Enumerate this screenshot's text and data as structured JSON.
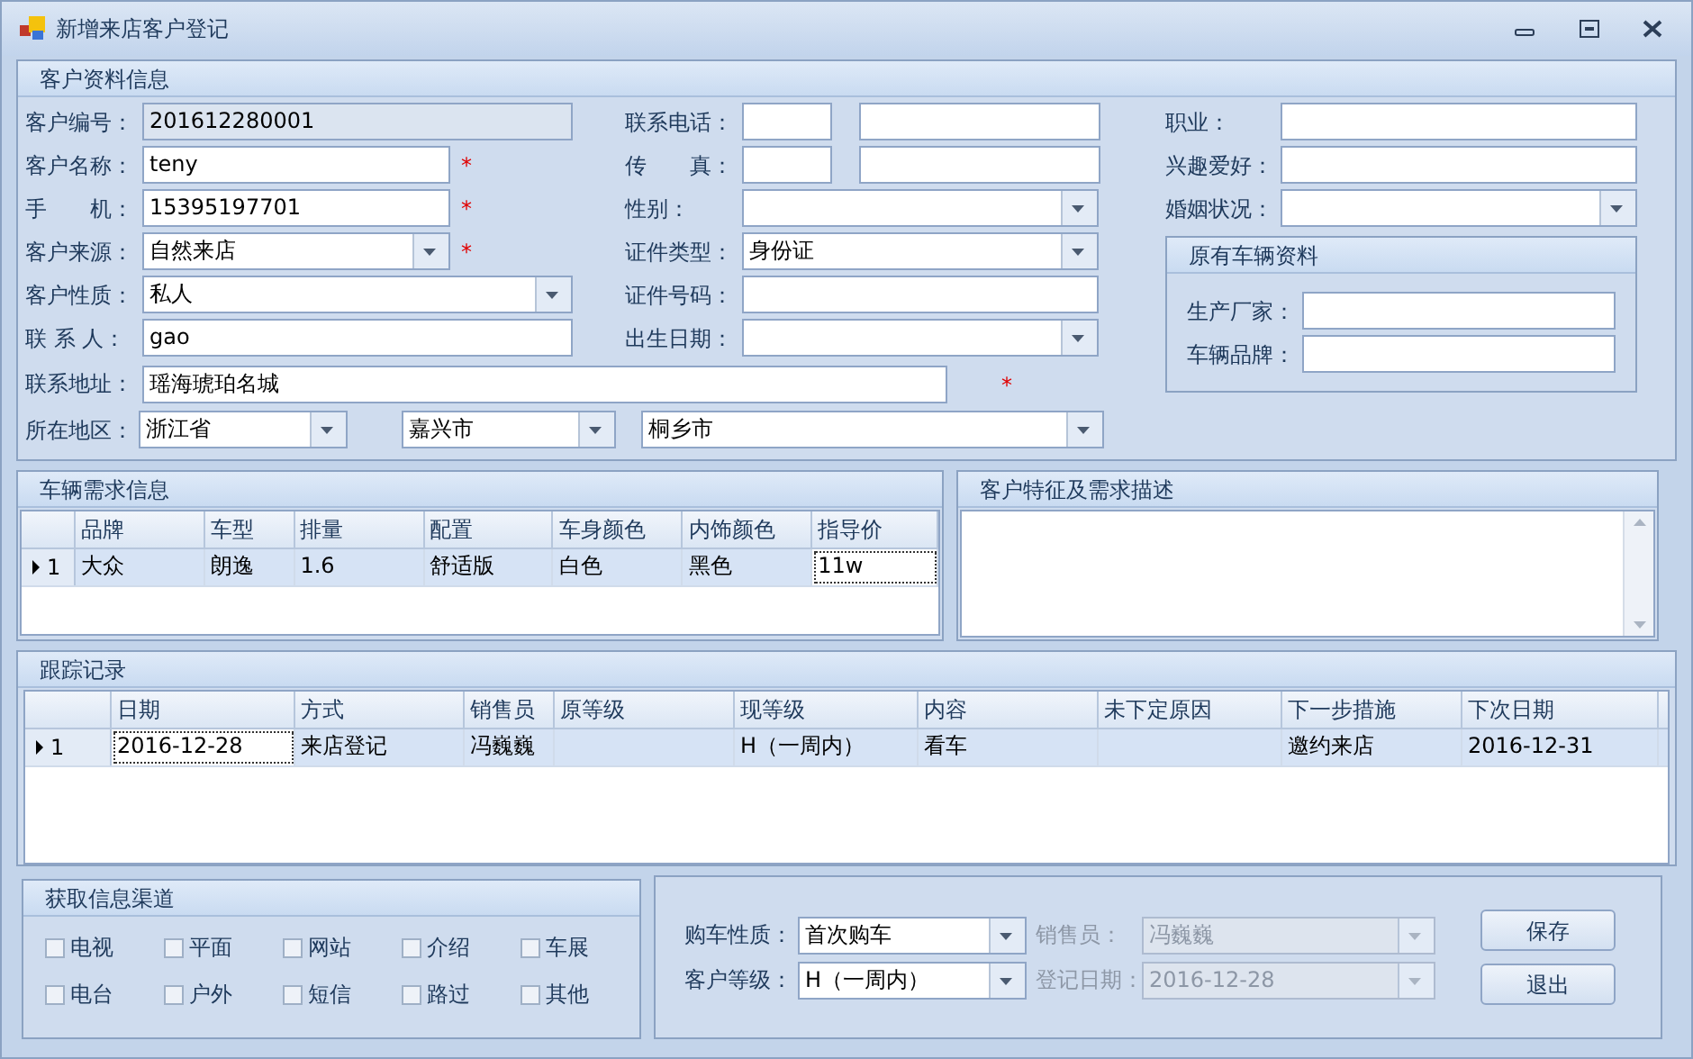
{
  "window": {
    "title": "新增来店客户登记"
  },
  "customer_info": {
    "title": "客户资料信息",
    "rows": [
      {
        "left": {
          "label": "客户编号：",
          "kind": "readonly",
          "value": "201612280001"
        },
        "right": {
          "label": "联系电话：",
          "kind": "pair"
        }
      },
      {
        "left": {
          "label": "客户名称：",
          "kind": "text",
          "value": "teny",
          "required_mark": "*"
        },
        "right": {
          "label": "传　　真：",
          "kind": "pair"
        }
      },
      {
        "left": {
          "label": "手　　机：",
          "kind": "text",
          "value": "15395197701",
          "required_mark": "*"
        },
        "right": {
          "label": "性别：",
          "kind": "combo"
        }
      },
      {
        "left": {
          "label": "客户来源：",
          "kind": "combo",
          "value": "自然来店",
          "required_mark": "*"
        },
        "right": {
          "label": "证件类型：",
          "kind": "combo",
          "value": "身份证"
        }
      },
      {
        "left": {
          "label": "客户性质：",
          "kind": "combo",
          "value": "私人"
        },
        "right": {
          "label": "证件号码：",
          "kind": "text"
        }
      },
      {
        "left": {
          "label": "联 系 人：",
          "kind": "text",
          "value": "gao"
        },
        "right": {
          "label": "出生日期：",
          "kind": "combo"
        }
      }
    ],
    "address": {
      "label": "联系地址：",
      "value": "瑶海琥珀名城",
      "required_mark": "*"
    },
    "region": {
      "label": "所在地区：",
      "values": [
        "浙江省",
        "嘉兴市",
        "桐乡市"
      ]
    },
    "extra": [
      {
        "label": "职业：",
        "kind": "text"
      },
      {
        "label": "兴趣爱好：",
        "kind": "text"
      },
      {
        "label": "婚姻状况：",
        "kind": "combo"
      }
    ],
    "old_vehicle": {
      "title": "原有车辆资料",
      "fields": [
        {
          "label": "生产厂家："
        },
        {
          "label": "车辆品牌："
        }
      ]
    }
  },
  "vehicle_needs": {
    "title": "车辆需求信息",
    "columns": [
      "品牌",
      "车型",
      "排量",
      "配置",
      "车身颜色",
      "内饰颜色",
      "指导价"
    ],
    "rows": [
      {
        "number": "1",
        "selected": true,
        "cells": [
          {
            "text": "大众",
            "current": false
          },
          {
            "text": "朗逸",
            "current": false
          },
          {
            "text": "1.6",
            "current": false
          },
          {
            "text": "舒适版",
            "current": false
          },
          {
            "text": "白色",
            "current": false
          },
          {
            "text": "黑色",
            "current": false
          },
          {
            "text": "11w",
            "current": true
          }
        ]
      }
    ]
  },
  "description": {
    "title": "客户特征及需求描述"
  },
  "tracking": {
    "title": "跟踪记录",
    "columns": [
      "日期",
      "方式",
      "销售员",
      "原等级",
      "现等级",
      "内容",
      "未下定原因",
      "下一步措施",
      "下次日期"
    ],
    "rows": [
      {
        "number": "1",
        "selected": true,
        "cells": [
          {
            "text": "2016-12-28",
            "current": true
          },
          {
            "text": "来店登记",
            "current": false
          },
          {
            "text": "冯巍巍",
            "current": false
          },
          {
            "current": false
          },
          {
            "text": "H（一周内）",
            "current": false
          },
          {
            "text": "看车",
            "current": false
          },
          {
            "current": false
          },
          {
            "text": "邀约来店",
            "current": false
          },
          {
            "text": "2016-12-31",
            "current": false
          }
        ]
      }
    ]
  },
  "channels": {
    "title": "获取信息渠道",
    "options": [
      {
        "label": "电视",
        "checked": false
      },
      {
        "label": "平面",
        "checked": false
      },
      {
        "label": "网站",
        "checked": false
      },
      {
        "label": "介绍",
        "checked": false
      },
      {
        "label": "车展",
        "checked": false
      },
      {
        "label": "电台",
        "checked": false
      },
      {
        "label": "户外",
        "checked": false
      },
      {
        "label": "短信",
        "checked": false
      },
      {
        "label": "路过",
        "checked": false
      },
      {
        "label": "其他",
        "checked": false
      }
    ]
  },
  "purchase": {
    "fields": [
      {
        "label": "购车性质：",
        "value": "首次购车",
        "disabled": false
      },
      {
        "label": "销售员：",
        "value": "冯巍巍",
        "disabled": true
      },
      {
        "label": "客户等级：",
        "value": "H（一周内）",
        "disabled": false
      },
      {
        "label": "登记日期：",
        "value": "2016-12-28",
        "disabled": true
      }
    ],
    "buttons": [
      "保存",
      "退出"
    ]
  }
}
